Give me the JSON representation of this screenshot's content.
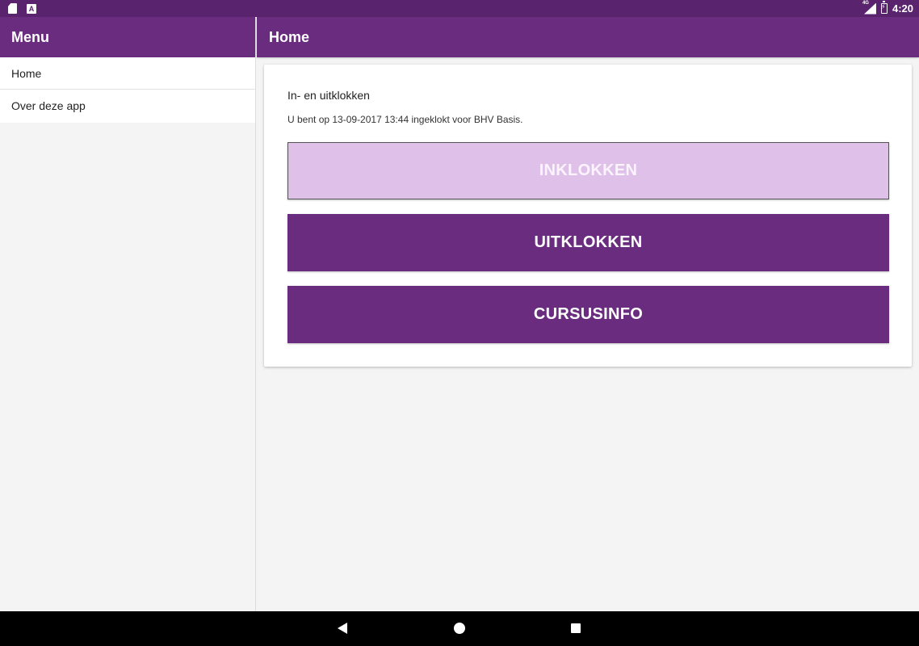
{
  "status_bar": {
    "left_icons": [
      "sd-card-icon",
      "a-notification-icon"
    ],
    "network_label": "4G",
    "time": "4:20"
  },
  "drawer": {
    "title": "Menu",
    "items": [
      {
        "label": "Home"
      },
      {
        "label": "Over deze app"
      }
    ]
  },
  "appbar": {
    "title": "Home"
  },
  "card": {
    "title": "In- en uitklokken",
    "status": "U bent op 13-09-2017 13:44 ingeklokt voor BHV Basis.",
    "buttons": {
      "clock_in": "INKLOKKEN",
      "clock_out": "UITKLOKKEN",
      "course_info": "CURSUSINFO"
    }
  },
  "colors": {
    "primary": "#6a2c7e",
    "primary_dark": "#5a236d",
    "disabled_button": "#dfc0e9",
    "background": "#f4f4f4"
  },
  "nav_bar": {
    "icons": [
      "back-icon",
      "home-icon",
      "recents-icon"
    ]
  }
}
